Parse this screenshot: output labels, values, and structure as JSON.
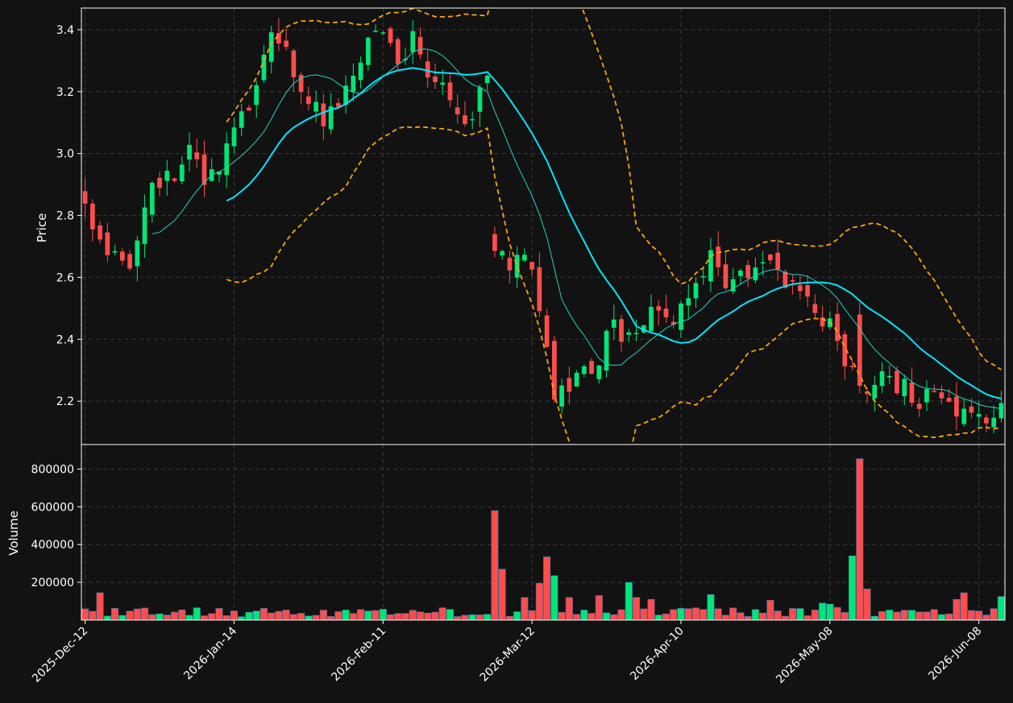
{
  "chart_data": {
    "type": "candlestick",
    "colors": {
      "background": "#121212",
      "up": "#00e676",
      "down": "#ff4d4d",
      "ma_fast": "#22d3c5",
      "ma_slow": "#00e5ff",
      "bollinger": "#ffa500",
      "grid": "#3a3a3a"
    },
    "price_panel": {
      "ylabel": "Price",
      "ylim": [
        2.06,
        3.47
      ],
      "yticks": [
        "2.2",
        "2.4",
        "2.6",
        "2.8",
        "3.0",
        "3.2",
        "3.4"
      ],
      "ytick_values": [
        2.2,
        2.4,
        2.6,
        2.8,
        3.0,
        3.2,
        3.4
      ]
    },
    "volume_panel": {
      "ylabel": "Volume",
      "ylim": [
        0,
        930000
      ],
      "yticks": [
        "200000",
        "400000",
        "600000",
        "800000"
      ],
      "ytick_values": [
        200000,
        400000,
        600000,
        800000
      ]
    },
    "x_count": 124,
    "x_ticks": [
      {
        "label": "2025-Dec-12",
        "index": 0
      },
      {
        "label": "2026-Jan-14",
        "index": 20
      },
      {
        "label": "2026-Feb-11",
        "index": 40
      },
      {
        "label": "2026-Mar-12",
        "index": 60
      },
      {
        "label": "2026-Apr-10",
        "index": 80
      },
      {
        "label": "2026-May-08",
        "index": 100
      },
      {
        "label": "2026-Jun-08",
        "index": 120
      }
    ],
    "price_keypoints": [
      [
        0,
        2.84
      ],
      [
        2,
        2.74
      ],
      [
        4,
        2.66
      ],
      [
        6,
        2.65
      ],
      [
        8,
        2.85
      ],
      [
        10,
        2.9
      ],
      [
        12,
        2.94
      ],
      [
        14,
        3.0
      ],
      [
        16,
        2.93
      ],
      [
        18,
        2.97
      ],
      [
        20,
        3.06
      ],
      [
        22,
        3.15
      ],
      [
        24,
        3.34
      ],
      [
        26,
        3.38
      ],
      [
        28,
        3.27
      ],
      [
        30,
        3.18
      ],
      [
        32,
        3.12
      ],
      [
        34,
        3.15
      ],
      [
        36,
        3.22
      ],
      [
        38,
        3.35
      ],
      [
        40,
        3.42
      ],
      [
        42,
        3.28
      ],
      [
        44,
        3.38
      ],
      [
        46,
        3.25
      ],
      [
        48,
        3.2
      ],
      [
        50,
        3.1
      ],
      [
        52,
        3.12
      ],
      [
        54,
        3.25
      ],
      [
        55,
        2.72
      ],
      [
        57,
        2.65
      ],
      [
        59,
        2.7
      ],
      [
        61,
        2.5
      ],
      [
        63,
        2.22
      ],
      [
        65,
        2.24
      ],
      [
        67,
        2.28
      ],
      [
        69,
        2.35
      ],
      [
        71,
        2.45
      ],
      [
        73,
        2.4
      ],
      [
        75,
        2.45
      ],
      [
        77,
        2.5
      ],
      [
        79,
        2.48
      ],
      [
        81,
        2.55
      ],
      [
        83,
        2.6
      ],
      [
        84,
        2.7
      ],
      [
        86,
        2.6
      ],
      [
        88,
        2.6
      ],
      [
        90,
        2.65
      ],
      [
        92,
        2.63
      ],
      [
        94,
        2.6
      ],
      [
        96,
        2.55
      ],
      [
        98,
        2.5
      ],
      [
        100,
        2.45
      ],
      [
        104,
        2.22
      ],
      [
        106,
        2.25
      ],
      [
        108,
        2.28
      ],
      [
        110,
        2.24
      ],
      [
        112,
        2.21
      ],
      [
        114,
        2.2
      ],
      [
        116,
        2.17
      ],
      [
        118,
        2.15
      ],
      [
        120,
        2.14
      ],
      [
        122,
        2.13
      ],
      [
        123,
        2.2
      ]
    ],
    "volume_base": 45000,
    "volume_spikes": [
      [
        2,
        145000
      ],
      [
        55,
        580000
      ],
      [
        56,
        270000
      ],
      [
        59,
        120000
      ],
      [
        61,
        195000
      ],
      [
        62,
        335000
      ],
      [
        63,
        235000
      ],
      [
        65,
        120000
      ],
      [
        69,
        130000
      ],
      [
        73,
        200000
      ],
      [
        74,
        120000
      ],
      [
        76,
        110000
      ],
      [
        84,
        135000
      ],
      [
        92,
        105000
      ],
      [
        99,
        90000
      ],
      [
        100,
        85000
      ],
      [
        103,
        340000
      ],
      [
        104,
        855000
      ],
      [
        105,
        165000
      ],
      [
        117,
        110000
      ],
      [
        118,
        145000
      ],
      [
        123,
        125000
      ]
    ],
    "volume_up_days": [
      3,
      5,
      10,
      14,
      15,
      21,
      22,
      23,
      30,
      35,
      38,
      40,
      49,
      52,
      54,
      58,
      63,
      67,
      70,
      73,
      77,
      80,
      84,
      90,
      96,
      99,
      100,
      103,
      106,
      108,
      111,
      115,
      123
    ],
    "ma_fast_period": 10,
    "ma_slow_period": 20,
    "bollinger_k": 2
  }
}
